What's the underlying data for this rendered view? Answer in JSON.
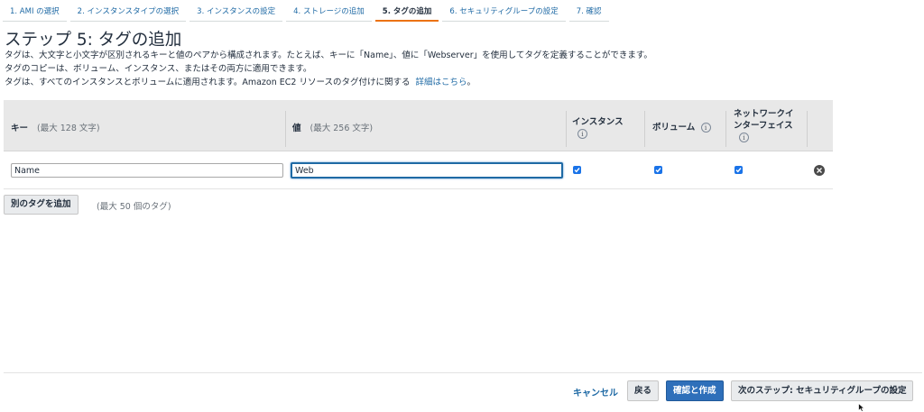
{
  "wizard": {
    "steps": [
      {
        "label": "1. AMI の選択"
      },
      {
        "label": "2. インスタンスタイプの選択"
      },
      {
        "label": "3. インスタンスの設定"
      },
      {
        "label": "4. ストレージの追加"
      },
      {
        "label": "5. タグの追加"
      },
      {
        "label": "6. セキュリティグループの設定"
      },
      {
        "label": "7. 確認"
      }
    ],
    "active_step": 5
  },
  "page": {
    "title": "ステップ 5: タグの追加",
    "desc_line1": "タグは、大文字と小文字が区別されるキーと値のペアから構成されます。たとえば、キーに「Name」、値に「Webserver」を使用してタグを定義することができます。",
    "desc_line2": "タグのコピーは、ボリューム、インスタンス、またはその両方に適用できます。",
    "desc_line3": "タグは、すべてのインスタンスとボリュームに適用されます。Amazon EC2 リソースのタグ付けに関する",
    "desc_link": "詳細はこちら",
    "desc_suffix": "。"
  },
  "table": {
    "headers": {
      "key": "キー",
      "key_hint": "(最大 128 文字)",
      "value": "値",
      "value_hint": "(最大 256 文字)",
      "instances": "インスタンス",
      "volumes": "ボリューム",
      "eni_line1": "ネットワークイ",
      "eni_line2": "ンターフェイス",
      "info_glyph": "i"
    },
    "rows": [
      {
        "key": "Name",
        "value": "Web",
        "instances": true,
        "volumes": true,
        "network_interfaces": true
      }
    ]
  },
  "actions": {
    "add_tag": "別のタグを追加",
    "max_note": "(最大 50 個のタグ)"
  },
  "footer": {
    "cancel": "キャンセル",
    "back": "戻る",
    "review_launch": "確認と作成",
    "next": "次のステップ: セキュリティグループの設定"
  },
  "colors": {
    "link": "#1f6aa5",
    "primary_button": "#2e6fba",
    "active_step_underline": "#ec7211",
    "checkbox": "#1a73e8"
  }
}
